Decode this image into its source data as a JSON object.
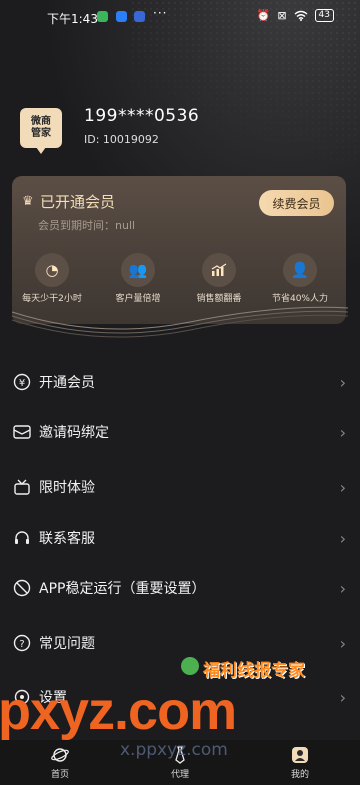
{
  "status_bar": {
    "time": "下午1:43",
    "more": "···",
    "battery": "43"
  },
  "profile": {
    "logo_line1": "微商",
    "logo_line2": "管家",
    "phone": "199****0536",
    "id": "ID: 10019092"
  },
  "vip_card": {
    "title": "已开通会员",
    "expire": "会员到期时间：null",
    "renew_button": "续费会员",
    "features": [
      {
        "label": "每天少干2小时",
        "icon": "clock-icon"
      },
      {
        "label": "客户量倍增",
        "icon": "users-icon"
      },
      {
        "label": "销售额翻番",
        "icon": "chart-icon"
      },
      {
        "label": "节省40%人力",
        "icon": "person-icon"
      }
    ]
  },
  "menu": [
    {
      "label": "开通会员",
      "icon": "yuan-icon"
    },
    {
      "label": "邀请码绑定",
      "icon": "mail-icon"
    },
    {
      "label": "限时体验",
      "icon": "gift-icon"
    },
    {
      "label": "联系客服",
      "icon": "headset-icon"
    },
    {
      "label": "APP稳定运行（重要设置）",
      "icon": "shield-icon"
    },
    {
      "label": "常见问题",
      "icon": "question-icon"
    },
    {
      "label": "设置",
      "icon": "settings-icon"
    }
  ],
  "watermark": {
    "brand": "福利线报专家",
    "domain_big": "pxyz.com",
    "domain_small": "x.ppxyz.com"
  },
  "nav": [
    {
      "label": "首页",
      "icon": "planet-icon"
    },
    {
      "label": "代理",
      "icon": "tie-icon"
    },
    {
      "label": "我的",
      "icon": "profile-icon"
    }
  ],
  "colors": {
    "background": "#1c1c1e",
    "gold": "#f3dcb6",
    "card": "#4a403a",
    "watermark": "#f06422"
  }
}
